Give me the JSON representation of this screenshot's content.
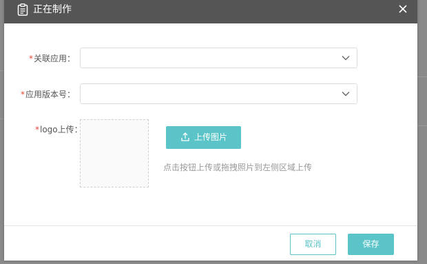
{
  "dialog": {
    "title": "正在制作",
    "close_label": "×"
  },
  "form": {
    "app": {
      "label": "关联应用：",
      "value": ""
    },
    "version": {
      "label": "应用版本号：",
      "value": ""
    },
    "logo": {
      "label": "logo上传：",
      "upload_button": "上传图片",
      "hint": "点击按钮上传或拖拽照片到左侧区域上传"
    }
  },
  "footer": {
    "cancel": "取消",
    "save": "保存"
  },
  "colors": {
    "header_bg": "#555555",
    "accent": "#5bc4c8",
    "required": "#e5483a"
  },
  "icons": [
    "document-icon",
    "close-icon",
    "chevron-down-icon",
    "upload-icon"
  ]
}
